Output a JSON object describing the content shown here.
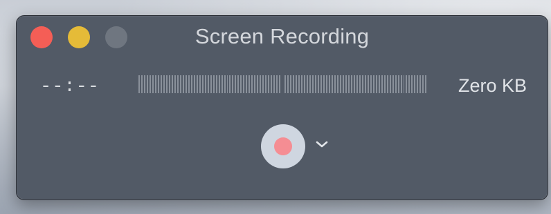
{
  "window": {
    "title": "Screen Recording"
  },
  "recording": {
    "elapsed_time": "--:--",
    "file_size": "Zero KB",
    "audio_level": 0
  },
  "controls": {
    "record_icon": "record-icon",
    "options_icon": "chevron-down-icon"
  },
  "colors": {
    "window_bg": "#525a66",
    "close": "#f45e56",
    "minimize": "#e5bb38",
    "zoom_disabled": "#6f7680",
    "record_button": "#cfd6e0",
    "record_dot": "#f58d93"
  }
}
